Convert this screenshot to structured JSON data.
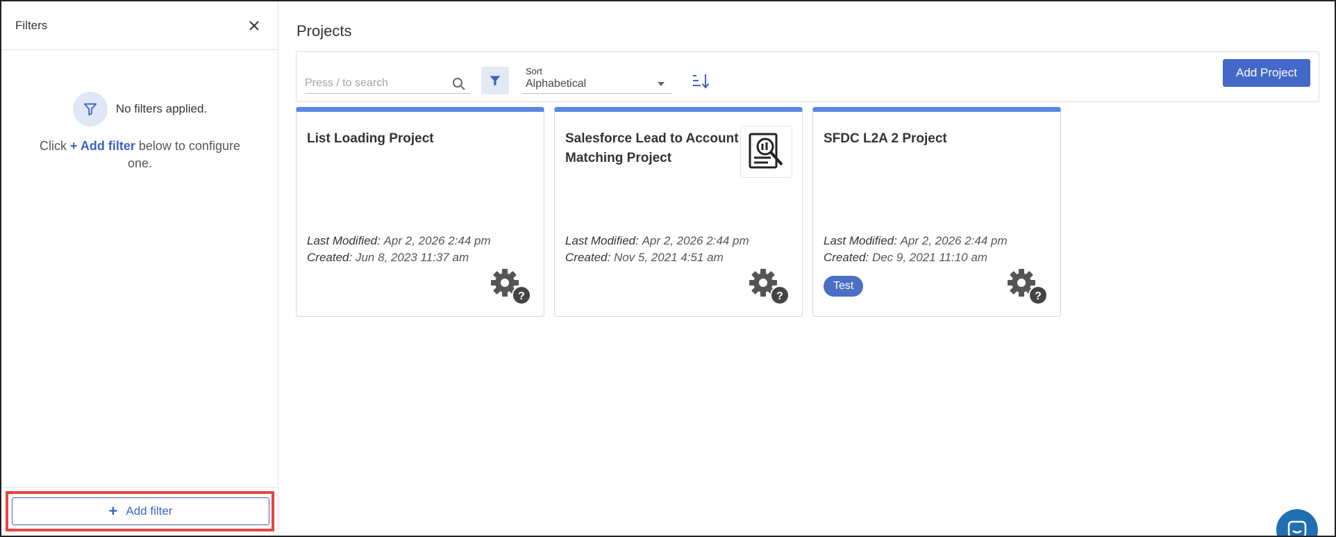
{
  "sidebar": {
    "title": "Filters",
    "empty_text": "No filters applied.",
    "help_prefix": "Click ",
    "help_link": "+ Add filter",
    "help_suffix": " below to configure one.",
    "add_filter_label": "Add filter"
  },
  "main": {
    "title": "Projects",
    "search_placeholder": "Press / to search",
    "sort_label": "Sort",
    "sort_value": "Alphabetical",
    "add_project_label": "Add Project"
  },
  "labels": {
    "last_modified": "Last Modified:",
    "created": "Created:"
  },
  "projects": [
    {
      "title": "List Loading Project",
      "last_modified": "Apr 2, 2026 2:44 pm",
      "created": "Jun 8, 2023 11:37 am",
      "tag": ""
    },
    {
      "title": "Salesforce Lead to Account Matching Project",
      "last_modified": "Apr 2, 2026 2:44 pm",
      "created": "Nov 5, 2021 4:51 am",
      "tag": ""
    },
    {
      "title": "SFDC L2A 2 Project",
      "last_modified": "Apr 2, 2026 2:44 pm",
      "created": "Dec 9, 2021 11:10 am",
      "tag": "Test"
    }
  ],
  "colors": {
    "accent": "#4468c8",
    "card_top": "#5b86e5",
    "highlight": "#e64545"
  }
}
